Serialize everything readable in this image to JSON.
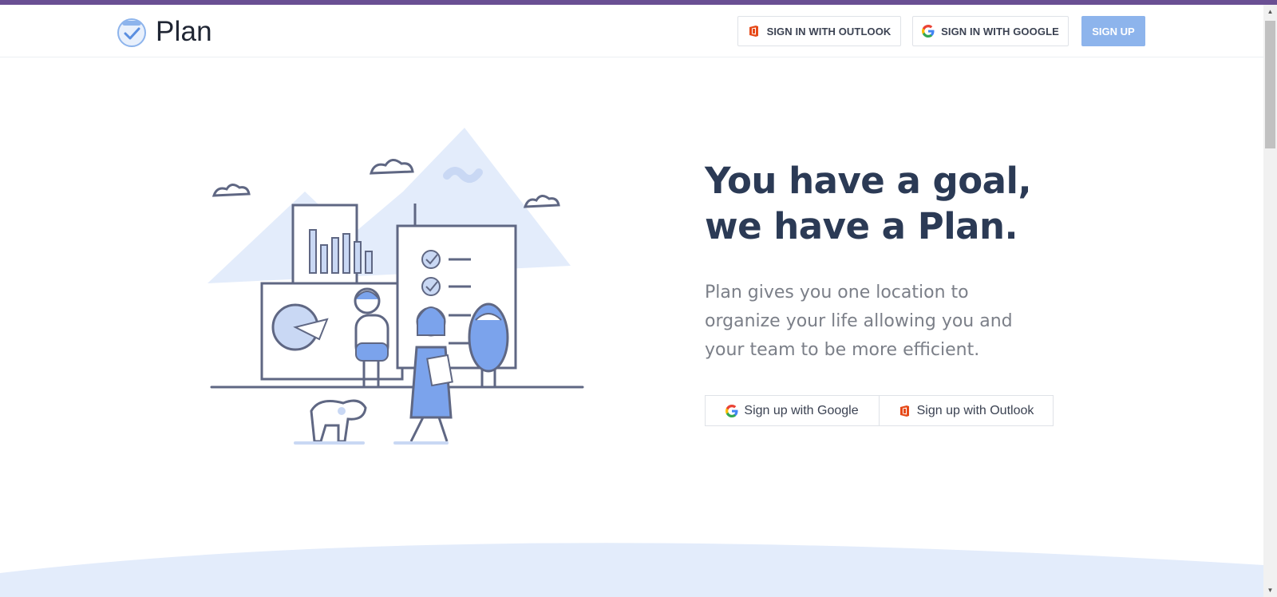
{
  "header": {
    "brand_name": "Plan",
    "signin_outlook_label": "SIGN IN WITH OUTLOOK",
    "signin_google_label": "SIGN IN WITH GOOGLE",
    "signup_label": "SIGN UP"
  },
  "hero": {
    "headline_line1": "You have a goal,",
    "headline_line2": "we have a Plan.",
    "subtext": "Plan gives you one location to organize your life allowing you and your team to be more efficient.",
    "cta_google_label": "Sign up with Google",
    "cta_outlook_label": "Sign up with Outlook"
  },
  "colors": {
    "accent_bar": "#6a4f93",
    "signup_button": "#8db4ec",
    "headline": "#2b3a55",
    "illustration_blue": "#7ba3ec",
    "illustration_light": "#e3ecfb"
  },
  "icons": {
    "logo": "plan-check-logo",
    "outlook": "office-icon",
    "google": "google-g-icon"
  }
}
